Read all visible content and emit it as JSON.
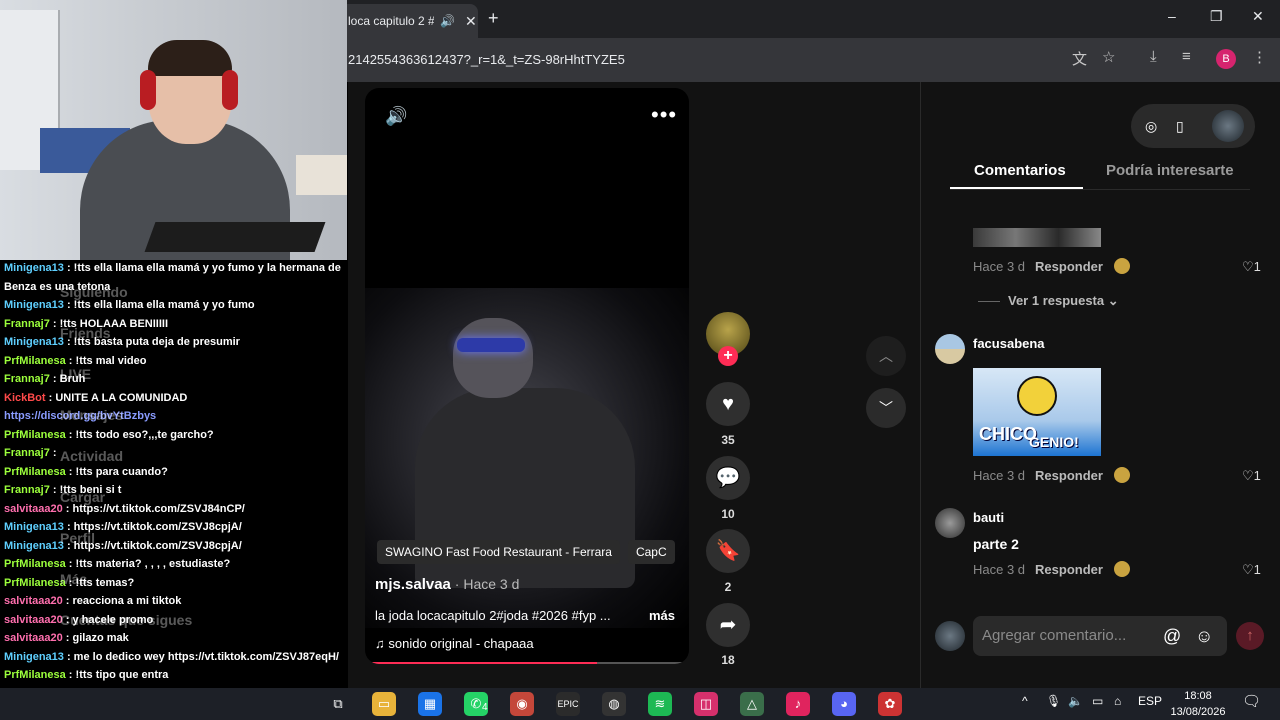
{
  "browser": {
    "tab_title": "loca capitulo 2 #",
    "audio_icon": "🔊",
    "close_icon": "✕",
    "new_tab": "+",
    "url": "2142554363612437?_r=1&_t=ZS-98rHhtTYZE5",
    "profile_initial": "B",
    "window_min": "–",
    "window_restore": "❐",
    "window_close": "✕"
  },
  "video": {
    "chips": [
      "SWAGINO Fast Food Restaurant - Ferrara",
      "CapC"
    ],
    "author": "mjs.salvaa",
    "posted": " · Hace 3 d",
    "description": "la joda locacapitulo 2#joda #2026 #fyp ...",
    "more": "más",
    "music": "sonido original - chapaaa",
    "progress": 0.72,
    "likes": "35",
    "comments": "10",
    "saves": "2",
    "shares": "18"
  },
  "comments_panel": {
    "tab_comments": "Comentarios",
    "tab_interest": "Podría interesarte",
    "view_replies": "Ver 1 respuesta",
    "reply_label": "Responder",
    "items": [
      {
        "user": "",
        "time": "Hace 3 d",
        "likes": "1"
      },
      {
        "user": "facusabena",
        "time": "Hace 3 d",
        "likes": "1",
        "sticker_top": "CHICO",
        "sticker_bottom": "GENIO!"
      },
      {
        "user": "bauti",
        "text": "parte 2",
        "time": "Hace 3 d",
        "likes": "1"
      }
    ],
    "input_placeholder": "Agregar comentario..."
  },
  "chat": [
    {
      "user": "Minigena13",
      "color": "#5fd0ff",
      "msg": " : !tts ella llama ella mamá y yo fumo y la hermana de"
    },
    {
      "user": "",
      "color": "#ffffff",
      "msg": "Benza es una tetona"
    },
    {
      "user": "Minigena13",
      "color": "#5fd0ff",
      "msg": " : !tts ella llama ella mamá y yo fumo"
    },
    {
      "user": "Frannaj7",
      "color": "#9cff3c",
      "msg": " : !tts HOLAAA BENIIIII"
    },
    {
      "user": "Minigena13",
      "color": "#5fd0ff",
      "msg": " : !tts basta puta deja de presumir"
    },
    {
      "user": "PrfMilanesa",
      "color": "#9cff3c",
      "msg": " : !tts mal video"
    },
    {
      "user": "Frannaj7",
      "color": "#9cff3c",
      "msg": " : Bruh"
    },
    {
      "user": "KickBot",
      "color": "#ff4a4a",
      "msg": " : UNITE A LA COMUNIDAD"
    },
    {
      "user": "",
      "color": "#8a9cff",
      "msg": "https://discord.gg/bvYtBzbys"
    },
    {
      "user": "PrfMilanesa",
      "color": "#9cff3c",
      "msg": " : !tts todo eso?,,,te garcho?"
    },
    {
      "user": "Frannaj7",
      "color": "#9cff3c",
      "msg": " : "
    },
    {
      "user": "PrfMilanesa",
      "color": "#9cff3c",
      "msg": " : !tts para cuando?"
    },
    {
      "user": "Frannaj7",
      "color": "#9cff3c",
      "msg": " : !tts beni si t"
    },
    {
      "user": "salvitaaa20",
      "color": "#ff6fae",
      "msg": " : https://vt.tiktok.com/ZSVJ84nCP/"
    },
    {
      "user": "Minigena13",
      "color": "#5fd0ff",
      "msg": " : https://vt.tiktok.com/ZSVJ8cpjA/"
    },
    {
      "user": "Minigena13",
      "color": "#5fd0ff",
      "msg": " : https://vt.tiktok.com/ZSVJ8cpjA/"
    },
    {
      "user": "PrfMilanesa",
      "color": "#9cff3c",
      "msg": " : !tts materia? , , , , estudiaste?"
    },
    {
      "user": "PrfMilanesa",
      "color": "#9cff3c",
      "msg": " : !tts temas?"
    },
    {
      "user": "salvitaaa20",
      "color": "#ff6fae",
      "msg": " : reacciona a mi tiktok"
    },
    {
      "user": "salvitaaa20",
      "color": "#ff6fae",
      "msg": " : y hacele promo"
    },
    {
      "user": "salvitaaa20",
      "color": "#ff6fae",
      "msg": " : gilazo mak"
    },
    {
      "user": "Minigena13",
      "color": "#5fd0ff",
      "msg": " : me lo dedico wey https://vt.tiktok.com/ZSVJ87eqH/"
    },
    {
      "user": "PrfMilanesa",
      "color": "#9cff3c",
      "msg": " : !tts tipo que entra"
    }
  ],
  "ghost_sidebar": [
    "Siguiendo",
    "Friends",
    "LIVE",
    "Mensajes",
    "Actividad",
    "Cargar",
    "Perfil",
    "Más",
    "Cuentas que sigues"
  ],
  "taskbar": {
    "lang": "ESP",
    "time": "18:08",
    "date": "13/08/2026",
    "whatsapp_badge": "4"
  }
}
